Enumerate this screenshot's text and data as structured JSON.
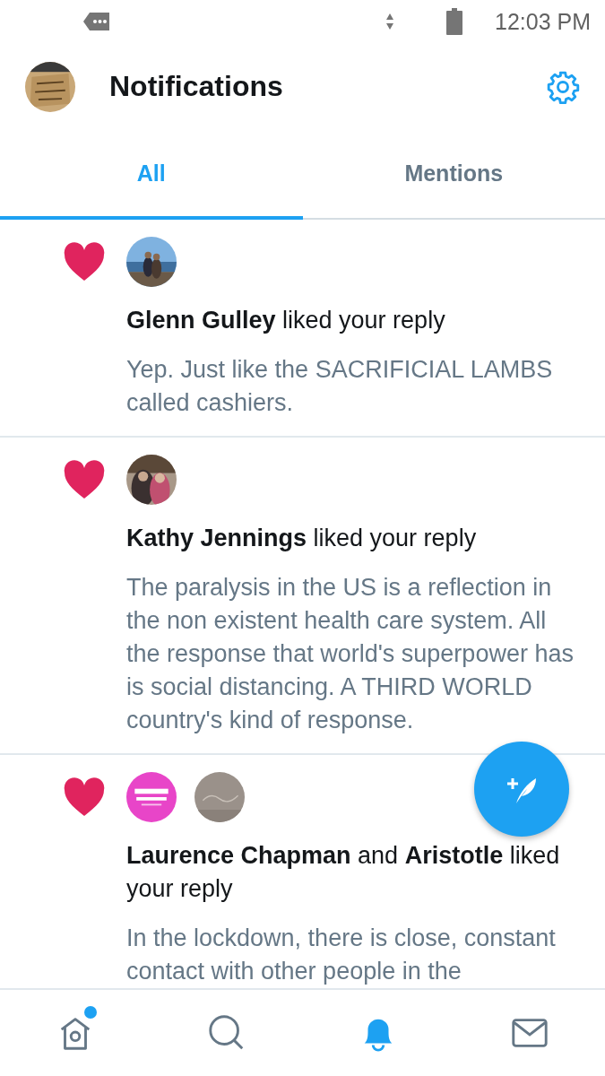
{
  "status_bar": {
    "time": "12:03 PM"
  },
  "header": {
    "title": "Notifications"
  },
  "tabs": [
    {
      "label": "All",
      "selected": true
    },
    {
      "label": "Mentions",
      "selected": false
    }
  ],
  "notifications": [
    {
      "kind": "like",
      "headline": "**Glenn Gulley** liked your reply",
      "text": "Yep. Just like the SACRIFICIAL LAMBS called cashiers."
    },
    {
      "kind": "like",
      "headline": "**Kathy  Jennings** liked your reply",
      "text": "The paralysis in the US is a reflection in the non existent health care system.  All the response that world's superpower has is social distancing. A THIRD WORLD country's kind of response."
    },
    {
      "kind": "like",
      "headline": "**Laurence Chapman** and **Aristotle** liked your reply",
      "text": "In the lockdown, there is close, constant contact with other people in the"
    }
  ],
  "bottom_nav": [
    {
      "kind": "home",
      "selected": false,
      "badge": true
    },
    {
      "kind": "search",
      "selected": false,
      "badge": false
    },
    {
      "kind": "notifications",
      "selected": true,
      "badge": false
    },
    {
      "kind": "messages",
      "selected": false,
      "badge": false
    }
  ]
}
